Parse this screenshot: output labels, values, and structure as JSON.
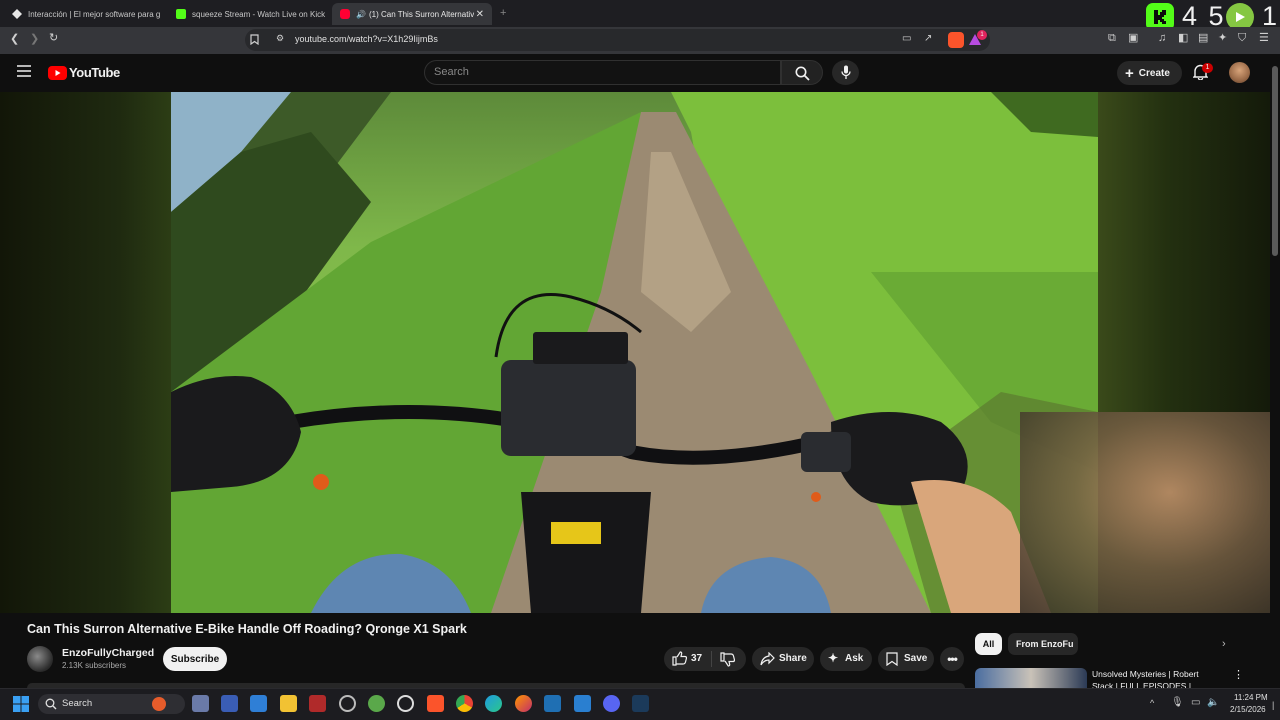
{
  "browser": {
    "tabs": [
      {
        "label": "Interacción | El mejor software para g"
      },
      {
        "label": "squeeze Stream - Watch Live on Kick"
      },
      {
        "label": "(1) Can This Surron Alternativ"
      }
    ],
    "new_tab_symbol": "+",
    "url": "youtube.com/watch?v=X1h29IijmBs",
    "brave_badge": "1"
  },
  "overlay": {
    "kick_count": "4 5",
    "rumble_count": "1"
  },
  "youtube": {
    "logo_text": "YouTube",
    "search_placeholder": "Search",
    "create_label": "Create",
    "notification_badge": "1"
  },
  "video": {
    "title": "Can This Surron Alternative E-Bike Handle Off Roading? Qronge X1 Spark",
    "channel_name": "EnzoFullyCharged",
    "subscribers": "2.13K subscribers",
    "subscribe_label": "Subscribe",
    "likes": "37",
    "share_label": "Share",
    "ask_label": "Ask",
    "save_label": "Save"
  },
  "sidebar": {
    "chips": [
      {
        "label": "All"
      },
      {
        "label": "From EnzoFu"
      }
    ],
    "recommendation": {
      "title_line1": "Unsolved Mysteries | Robert",
      "title_line2": "Stack | FULL EPISODES |"
    }
  },
  "taskbar": {
    "search_label": "Search",
    "time": "11:24 PM",
    "date": "2/15/2026"
  },
  "colors": {
    "youtube_red": "#ff0000",
    "kick_green": "#53fc18",
    "rumble_green": "#85c742",
    "page_bg": "#0f0f0f"
  }
}
